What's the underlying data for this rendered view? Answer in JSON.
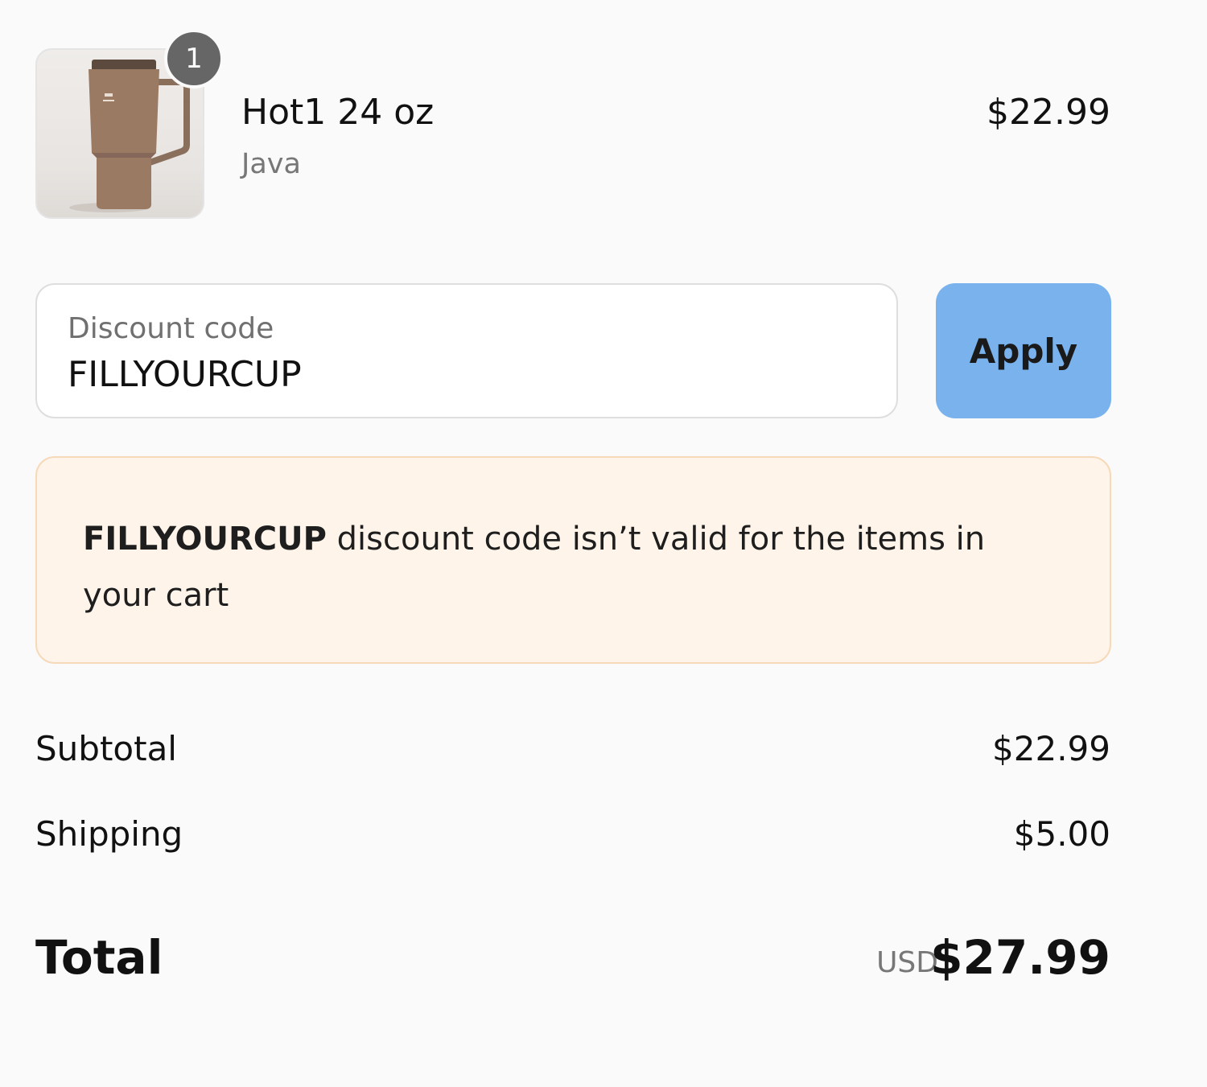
{
  "line_item": {
    "quantity": "1",
    "name": "Hot1 24 oz",
    "variant": "Java",
    "price": "$22.99",
    "image_icon": "tumbler-product-image"
  },
  "discount": {
    "label": "Discount code",
    "value": "FILLYOURCUP",
    "apply_label": "Apply"
  },
  "warning": {
    "code": "FILLYOURCUP",
    "message": "discount code isn’t valid for the items in your cart"
  },
  "summary": {
    "subtotal_label": "Subtotal",
    "subtotal_value": "$22.99",
    "shipping_label": "Shipping",
    "shipping_value": "$5.00",
    "total_label": "Total",
    "currency": "USD",
    "total_value": "$27.99"
  },
  "colors": {
    "background": "#fafafa",
    "apply_button": "#79b2ec",
    "warning_background": "#fff4e9",
    "warning_border": "#f6d9b9",
    "badge": "#666666"
  }
}
